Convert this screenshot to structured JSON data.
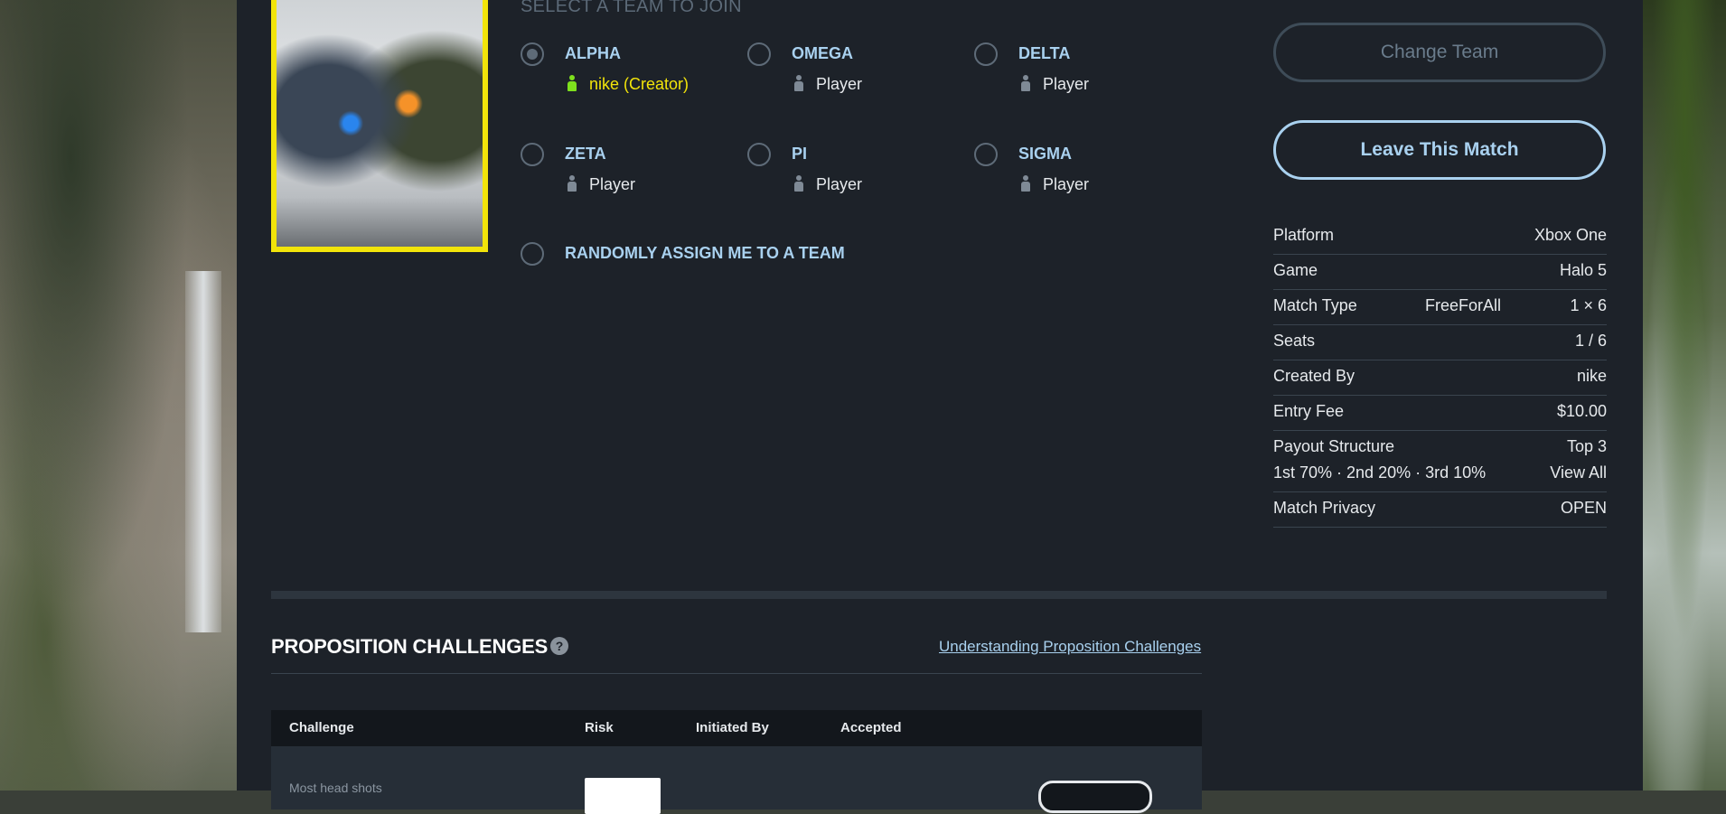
{
  "section_heading": "SELECT A TEAM TO JOIN",
  "teams": [
    {
      "name": "ALPHA",
      "member": "nike (Creator)",
      "selected": true
    },
    {
      "name": "OMEGA",
      "member": "Player",
      "selected": false
    },
    {
      "name": "DELTA",
      "member": "Player",
      "selected": false
    },
    {
      "name": "ZETA",
      "member": "Player",
      "selected": false
    },
    {
      "name": "PI",
      "member": "Player",
      "selected": false
    },
    {
      "name": "SIGMA",
      "member": "Player",
      "selected": false
    }
  ],
  "random_option": "RANDOMLY ASSIGN ME TO A TEAM",
  "buttons": {
    "change_team": "Change Team",
    "leave_match": "Leave This Match"
  },
  "details": {
    "platform_label": "Platform",
    "platform": "Xbox One",
    "game_label": "Game",
    "game": "Halo 5",
    "match_type_label": "Match Type",
    "match_type": "FreeForAll",
    "match_format": "1 × 6",
    "seats_label": "Seats",
    "seats": "1 / 6",
    "created_by_label": "Created By",
    "created_by": "nike",
    "entry_fee_label": "Entry Fee",
    "entry_fee": "$10.00",
    "payout_label": "Payout Structure",
    "payout_top": "Top 3",
    "payout_split": "1st 70%  ·  2nd 20%  ·  3rd 10%",
    "payout_view_all": "View All",
    "privacy_label": "Match Privacy",
    "privacy": "OPEN"
  },
  "propositions": {
    "title": "PROPOSITION CHALLENGES",
    "help": "?",
    "link": "Understanding Proposition Challenges",
    "columns": [
      "Challenge",
      "Risk",
      "Initiated By",
      "Accepted"
    ],
    "row_challenge": "Most head shots"
  },
  "colors": {
    "accent": "#a9d1ef",
    "creator": "#f2e40a",
    "creator_icon": "#7ee01d",
    "cover_border": "#f2e40a",
    "panel": "#1d2229"
  }
}
